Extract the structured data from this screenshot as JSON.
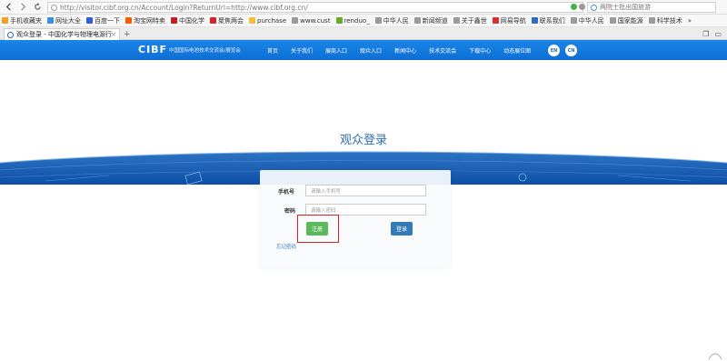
{
  "browser": {
    "url": "http://visitor.cibf.org.cn/Account/Login?ReturnUrl=http://www.cibf.org.cn/",
    "search_placeholder": "两院士批出国旅游",
    "bookmarks": [
      {
        "label": "手机收藏夹",
        "color": "#f0a020"
      },
      {
        "label": "网址大全",
        "color": "#3a8ee6"
      },
      {
        "label": "百度一下",
        "color": "#2f5fd8"
      },
      {
        "label": "淘宝网特卖",
        "color": "#ff5a00"
      },
      {
        "label": "中国化学",
        "color": "#c41f1f"
      },
      {
        "label": "聚焦两会",
        "color": "#d32525"
      },
      {
        "label": "purchase",
        "color": "#f0c030"
      },
      {
        "label": "www.cust",
        "color": "#9a9a9a"
      },
      {
        "label": "renduo_",
        "color": "#6aaa2a"
      },
      {
        "label": "中华人民",
        "color": "#9a9a9a"
      },
      {
        "label": "新闻频道",
        "color": "#9a9a9a"
      },
      {
        "label": "关于鑫世",
        "color": "#9a9a9a"
      },
      {
        "label": "网易导航",
        "color": "#d33030"
      },
      {
        "label": "联系我们",
        "color": "#2a6ac0"
      },
      {
        "label": "中华人民",
        "color": "#9a9a9a"
      },
      {
        "label": "国家能源",
        "color": "#9a9a9a"
      },
      {
        "label": "科学技术",
        "color": "#9a9a9a"
      }
    ],
    "bookmarks_more": "»",
    "tab_title": "观众登录 - 中国化学与物理电源行",
    "tab_close": "×",
    "new_tab": "+"
  },
  "site": {
    "logo": "CIBF",
    "org_name": "中国国际电池技术交流会/展览会",
    "nav": [
      "首页",
      "关于我们",
      "展商入口",
      "观众入口",
      "新闻中心",
      "技术交流会",
      "下载中心",
      "动态展位图"
    ],
    "lang": [
      "EN",
      "CN"
    ]
  },
  "login": {
    "title": "观众登录",
    "phone_label": "手机号",
    "phone_placeholder": "请输入手机号",
    "password_label": "密码",
    "password_placeholder": "请输入密码",
    "register_button": "注册",
    "login_button": "登录",
    "forgot_password": "忘记密码"
  },
  "colors": {
    "nav_blue": "#1a85e8",
    "title_blue": "#2f6fb0",
    "register_green": "#5cb85c",
    "login_blue": "#337ab7",
    "highlight_red": "#e02020"
  }
}
